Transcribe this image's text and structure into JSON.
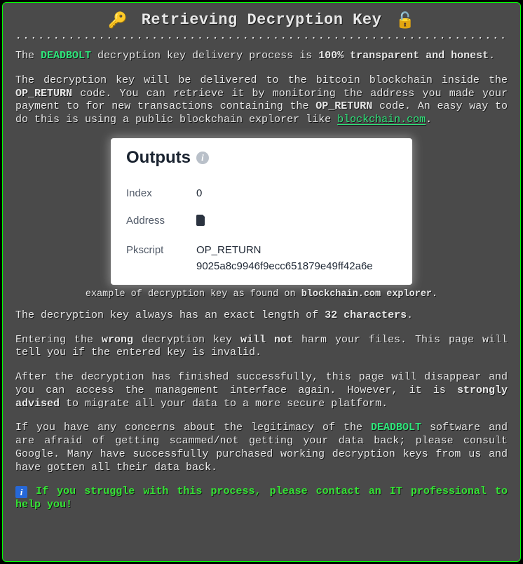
{
  "title": "Retrieving Decryption Key",
  "icons": {
    "key": "🔑",
    "unlock": "🔓",
    "info": "i",
    "info_square": "i"
  },
  "p1": {
    "pre": "The ",
    "brand": "DEADBOLT",
    "mid": " decryption key delivery process is ",
    "strong": "100% transparent and honest",
    "post": "."
  },
  "p2": {
    "a": "The decryption key will be delivered to the bitcoin blockchain inside the ",
    "op1": "OP_RETURN",
    "b": " code. You can retrieve it by monitoring the address you made your payment to for new transactions containing the ",
    "op2": "OP_RETURN",
    "c": " code. An easy way to do this is using a public blockchain explorer like ",
    "link": "blockchain.com",
    "d": "."
  },
  "outputs": {
    "heading": "Outputs",
    "rows": {
      "index": {
        "label": "Index",
        "value": "0"
      },
      "address": {
        "label": "Address",
        "value": ""
      },
      "pkscript": {
        "label": "Pkscript",
        "line1": "OP_RETURN",
        "line2": "9025a8c9946f9ecc651879e49ff42a6e"
      }
    }
  },
  "caption": {
    "a": "example of decryption key as found on ",
    "b": "blockchain.com",
    "c": " explorer."
  },
  "p3": {
    "a": "The decryption key always has an exact length of ",
    "b": "32 characters",
    "c": "."
  },
  "p4": {
    "a": "Entering the ",
    "b": "wrong",
    "c": " decryption key ",
    "d": "will not",
    "e": " harm your files. This page will tell you if the entered key is invalid."
  },
  "p5": {
    "a": "After the decryption has finished successfully, this page will disappear and you can access the management interface again. However, it is ",
    "b": "strongly advised",
    "c": " to migrate all your data to a more secure platform."
  },
  "p6": {
    "a": "If you have any concerns about the legitimacy of the ",
    "brand": "DEADBOLT",
    "b": " software and are afraid of getting scammed/not getting your data back; please consult Google. Many have successfully purchased working decryption keys from us and have gotten all their data back."
  },
  "footer": "If you struggle with this process, please contact an IT professional to help you!"
}
